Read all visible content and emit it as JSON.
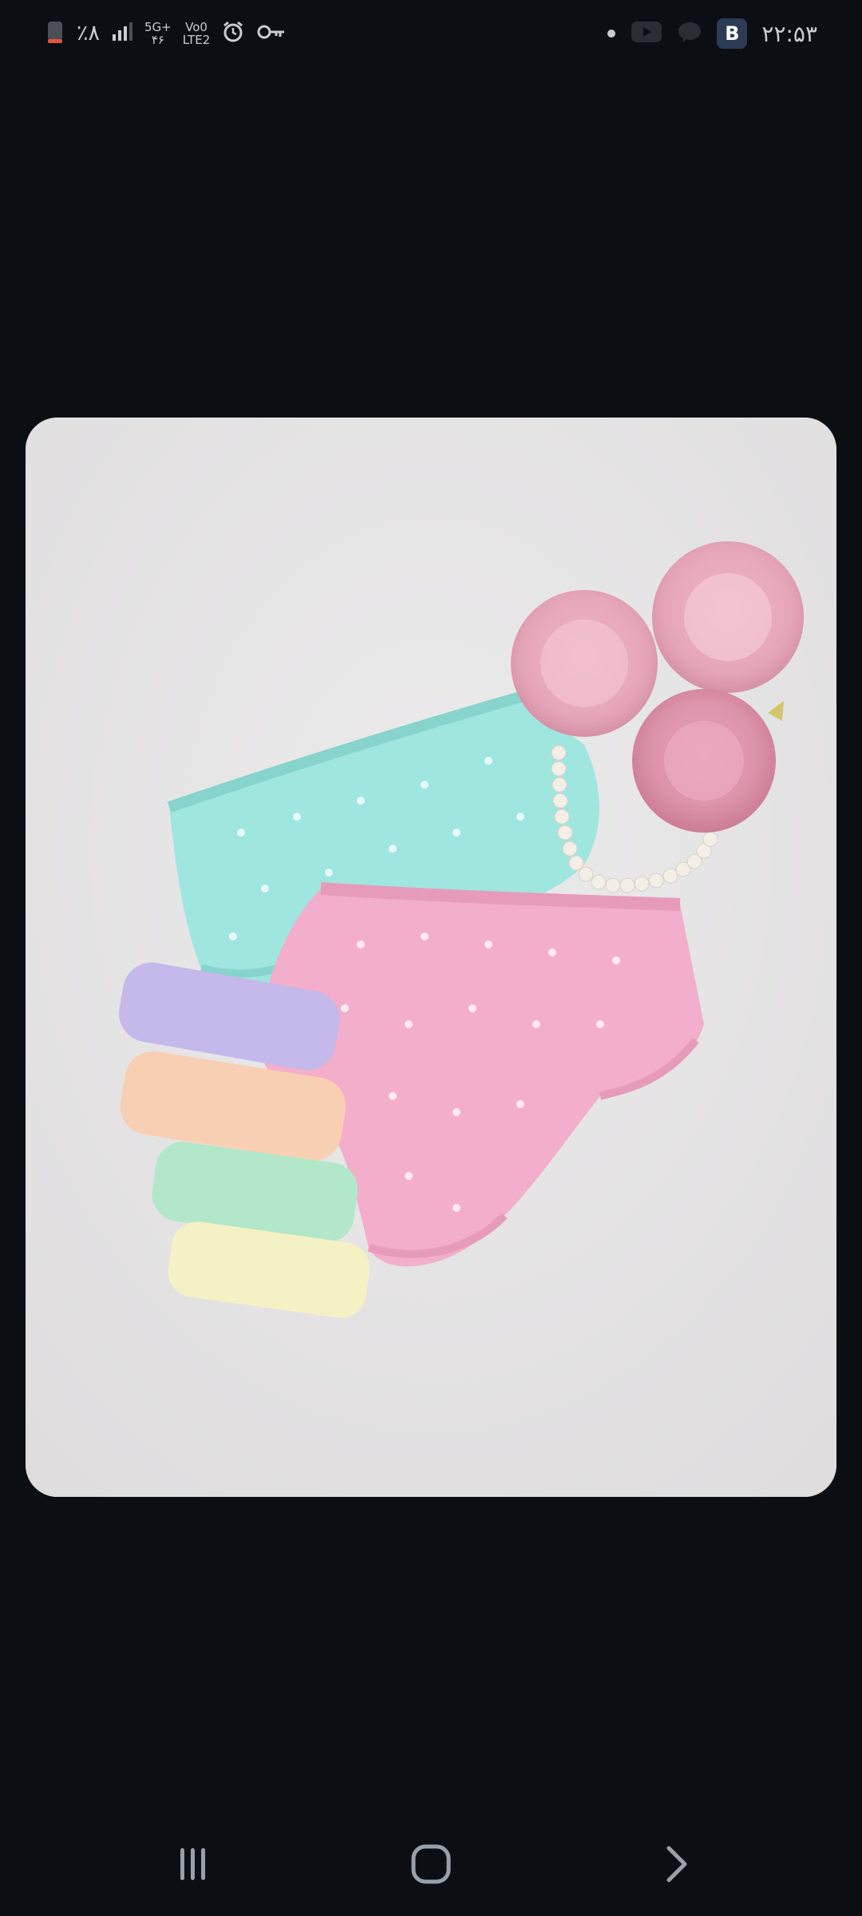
{
  "status_bar": {
    "left_indicator": "٪۸",
    "network_top": "5G+",
    "network_bottom": "۴۶",
    "lte_top": "Vo0",
    "lte_bottom": "LTE2",
    "clock": "۲۲:۵۳",
    "app_badge_letter": "B",
    "icons": [
      "battery-icon",
      "signal-icon",
      "alarm-icon",
      "key-icon",
      "dot-icon",
      "youtube-icon",
      "chat-icon",
      "app-badge-icon"
    ]
  },
  "photo": {
    "subject": "pastel baby underwear with peonies and pearls",
    "background_color": "#e6e4e5"
  },
  "nav_bar": {
    "icons": [
      "recent-apps-icon",
      "home-icon",
      "back-icon"
    ]
  }
}
